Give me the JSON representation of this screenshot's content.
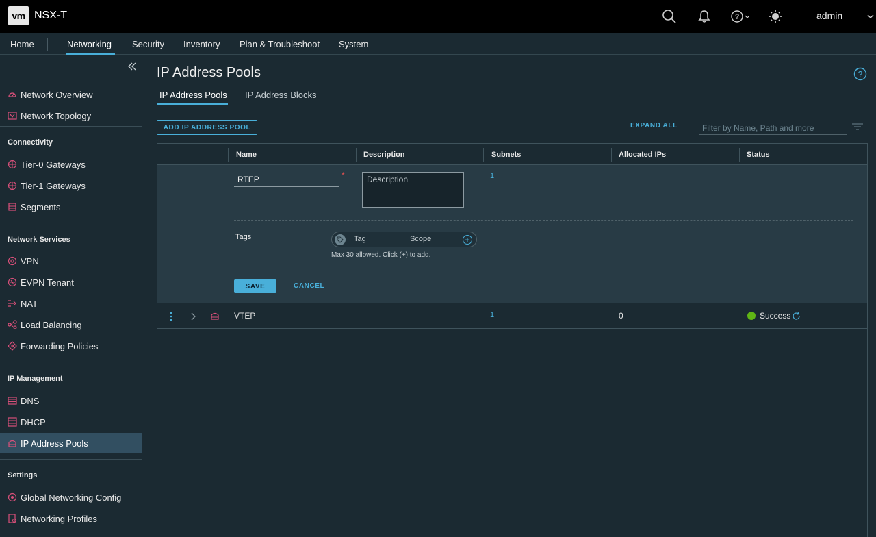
{
  "header": {
    "logo_text": "vm",
    "app_title": "NSX-T",
    "user": "admin"
  },
  "nav": {
    "items": [
      "Home",
      "Networking",
      "Security",
      "Inventory",
      "Plan & Troubleshoot",
      "System"
    ],
    "active": "Networking"
  },
  "sidebar": {
    "top_items": [
      {
        "label": "Network Overview",
        "icon": "dashboard-icon"
      },
      {
        "label": "Network Topology",
        "icon": "topology-icon"
      }
    ],
    "sections": [
      {
        "title": "Connectivity",
        "items": [
          {
            "label": "Tier-0 Gateways",
            "icon": "tier0-gateway-icon"
          },
          {
            "label": "Tier-1 Gateways",
            "icon": "tier1-gateway-icon"
          },
          {
            "label": "Segments",
            "icon": "segments-icon"
          }
        ]
      },
      {
        "title": "Network Services",
        "items": [
          {
            "label": "VPN",
            "icon": "vpn-icon"
          },
          {
            "label": "EVPN Tenant",
            "icon": "evpn-icon"
          },
          {
            "label": "NAT",
            "icon": "nat-icon"
          },
          {
            "label": "Load Balancing",
            "icon": "load-balancing-icon"
          },
          {
            "label": "Forwarding Policies",
            "icon": "forwarding-icon"
          }
        ]
      },
      {
        "title": "IP Management",
        "items": [
          {
            "label": "DNS",
            "icon": "dns-icon"
          },
          {
            "label": "DHCP",
            "icon": "dhcp-icon"
          },
          {
            "label": "IP Address Pools",
            "icon": "ip-pool-icon",
            "active": true
          }
        ]
      },
      {
        "title": "Settings",
        "items": [
          {
            "label": "Global Networking Config",
            "icon": "global-config-icon"
          },
          {
            "label": "Networking Profiles",
            "icon": "profiles-icon"
          }
        ]
      }
    ]
  },
  "main": {
    "title": "IP Address Pools",
    "tabs": [
      "IP Address Pools",
      "IP Address Blocks"
    ],
    "add_button": "ADD IP ADDRESS POOL",
    "expand_all": "EXPAND ALL",
    "filter_placeholder": "Filter by Name, Path and more",
    "columns": [
      "Name",
      "Description",
      "Subnets",
      "Allocated IPs",
      "Status"
    ],
    "edit_row": {
      "name_value": "RTEP",
      "required_mark": "*",
      "description_placeholder": "Description",
      "subnets": "1",
      "tags_label": "Tags",
      "tag_placeholder": "Tag",
      "scope_placeholder": "Scope",
      "tag_hint": "Max 30 allowed. Click (+) to add.",
      "save": "SAVE",
      "cancel": "CANCEL"
    },
    "rows": [
      {
        "name": "VTEP",
        "subnets": "1",
        "allocated_ips": "0",
        "status": "Success",
        "status_color": "#60b515"
      }
    ]
  },
  "colors": {
    "accent": "#49afd9",
    "icon_pink": "#d9507a",
    "background": "#1b2a32"
  }
}
